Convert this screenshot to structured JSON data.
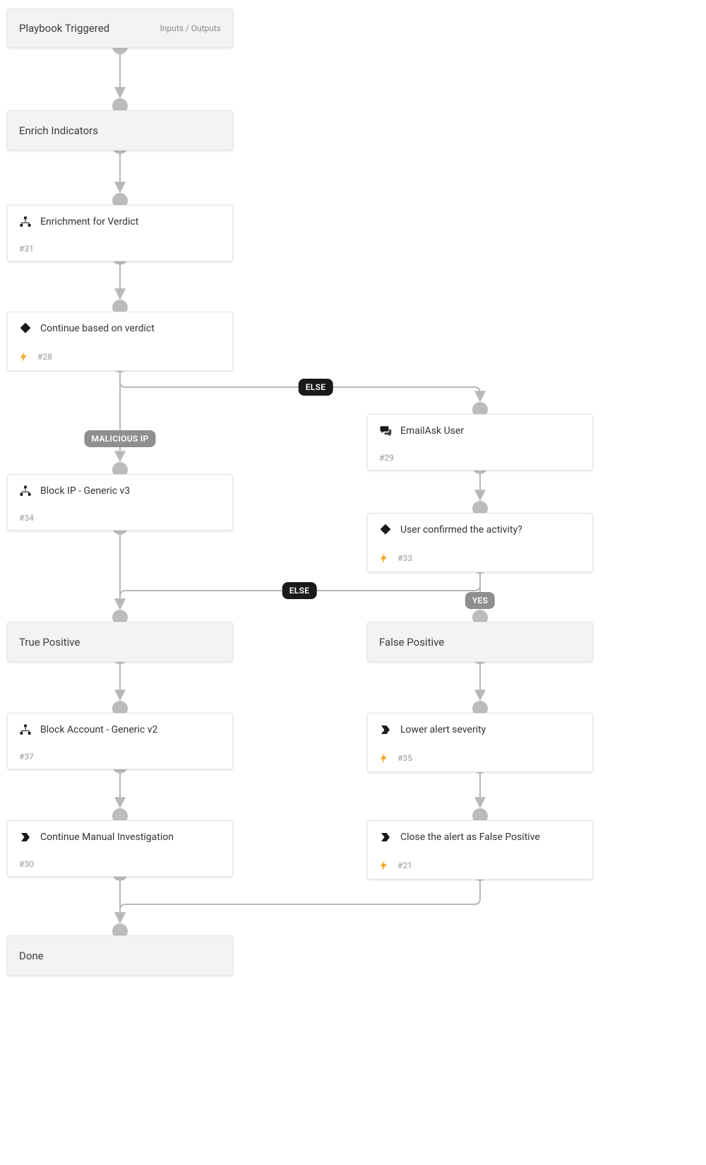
{
  "labels": {
    "io": "Inputs / Outputs",
    "else": "ELSE",
    "malicious": "MALICIOUS IP",
    "yes": "YES"
  },
  "nodes": {
    "triggered": {
      "title": "Playbook Triggered"
    },
    "enrich": {
      "title": "Enrich Indicators"
    },
    "enrichVerdict": {
      "title": "Enrichment for Verdict",
      "id": "#31"
    },
    "continueVerdict": {
      "title": "Continue based on verdict",
      "id": "#28"
    },
    "emailAsk": {
      "title": "EmailAsk User",
      "id": "#29"
    },
    "blockIP": {
      "title": "Block IP - Generic v3",
      "id": "#34"
    },
    "userConfirmed": {
      "title": "User confirmed the activity?",
      "id": "#33"
    },
    "truePositive": {
      "title": "True Positive"
    },
    "falsePositive": {
      "title": "False Positive"
    },
    "blockAccount": {
      "title": "Block Account - Generic v2",
      "id": "#37"
    },
    "lowerSeverity": {
      "title": "Lower alert severity",
      "id": "#35"
    },
    "continueManual": {
      "title": "Continue Manual Investigation",
      "id": "#30"
    },
    "closeAlert": {
      "title": "Close the alert as False Positive",
      "id": "#21"
    },
    "done": {
      "title": "Done"
    }
  }
}
